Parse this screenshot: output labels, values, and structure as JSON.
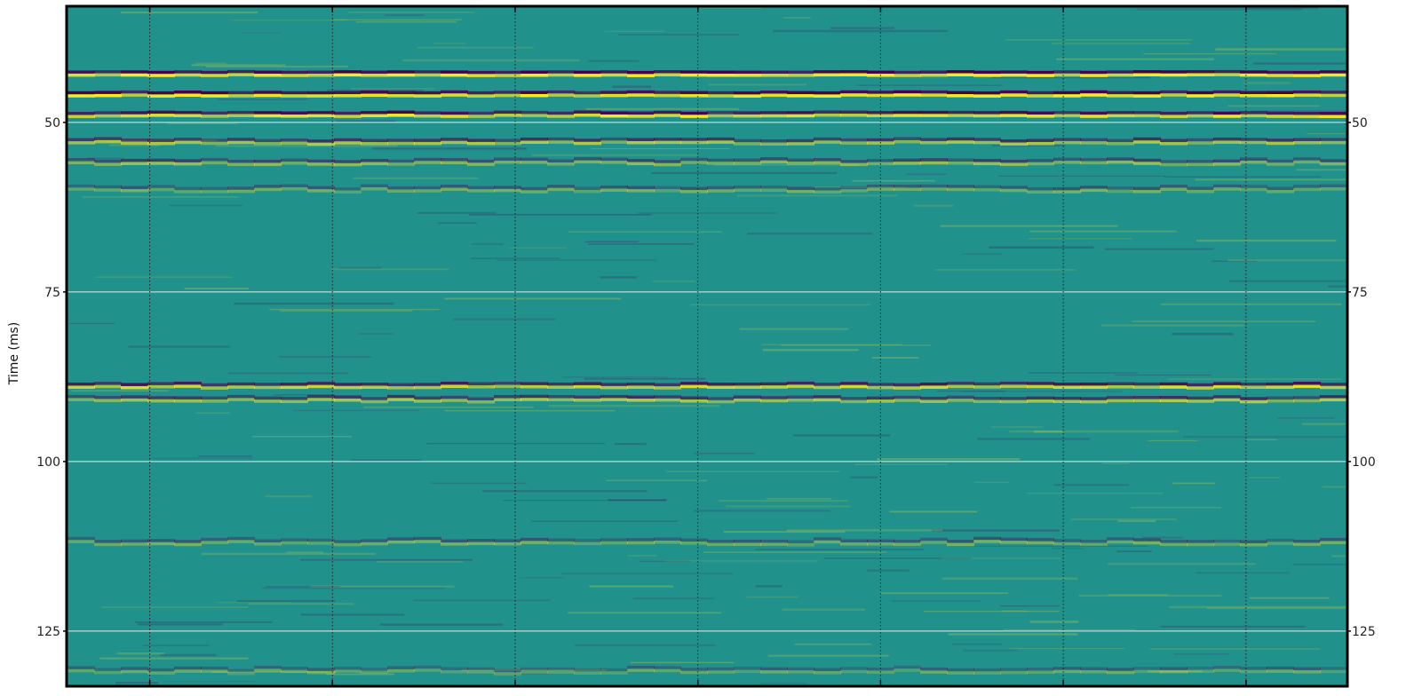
{
  "chart_data": {
    "type": "heatmap",
    "ylabel": "Time   (ms)",
    "yticks": [
      50,
      75,
      100,
      125
    ],
    "ylim": [
      133,
      33
    ],
    "x_gridlines": 7,
    "grid": true,
    "colormap": [
      "#440154",
      "#21918c",
      "#fde725"
    ],
    "reflectors": [
      {
        "time_ms": 43,
        "strength": 1.0
      },
      {
        "time_ms": 46,
        "strength": 1.0
      },
      {
        "time_ms": 49,
        "strength": 0.9
      },
      {
        "time_ms": 53,
        "strength": 0.6
      },
      {
        "time_ms": 56,
        "strength": 0.5
      },
      {
        "time_ms": 60,
        "strength": 0.35
      },
      {
        "time_ms": 89,
        "strength": 0.8
      },
      {
        "time_ms": 91,
        "strength": 0.6
      },
      {
        "time_ms": 112,
        "strength": 0.35
      },
      {
        "time_ms": 131,
        "strength": 0.3
      }
    ]
  }
}
